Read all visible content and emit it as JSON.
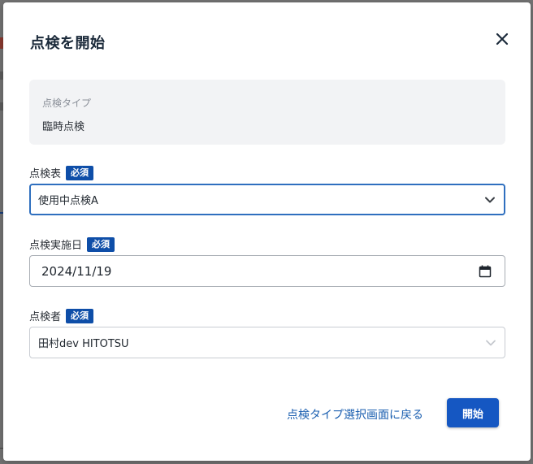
{
  "dialog": {
    "title": "点検を開始",
    "close_icon": "close-icon"
  },
  "inspection_type": {
    "label": "点検タイプ",
    "value": "臨時点検"
  },
  "checklist": {
    "label": "点検表",
    "required_badge": "必須",
    "selected_value": "使用中点検A"
  },
  "date": {
    "label": "点検実施日",
    "required_badge": "必須",
    "value": "2024/11/19"
  },
  "inspector": {
    "label": "点検者",
    "required_badge": "必須",
    "selected_value": "田村dev HITOTSU"
  },
  "footer": {
    "back_link": "点検タイプ選択画面に戻る",
    "start_button": "開始"
  },
  "colors": {
    "primary": "#1557c2",
    "required_badge": "#0e4ea8",
    "link": "#1b5fb0",
    "focus_border": "#2f6fbf"
  }
}
